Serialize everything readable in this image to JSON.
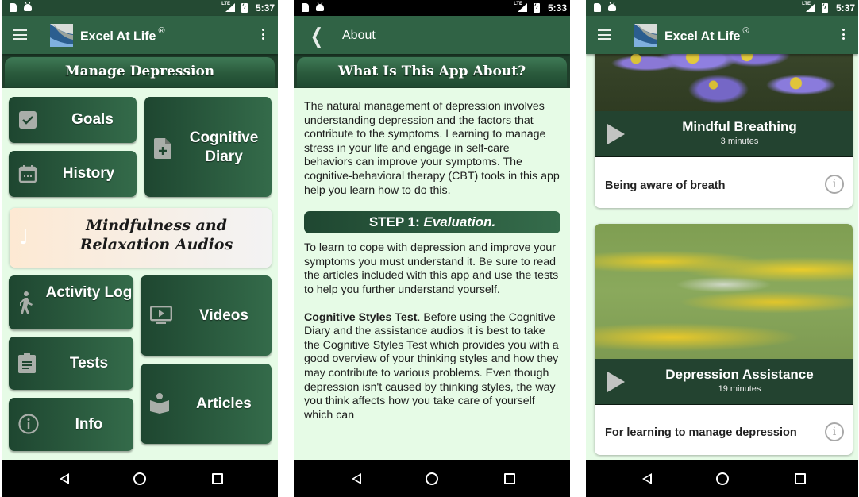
{
  "status_bars": {
    "phone1": {
      "time": "5:37",
      "network": "LTE"
    },
    "phone2": {
      "time": "5:33",
      "network": "LTE"
    },
    "phone3": {
      "time": "5:37",
      "network": "LTE"
    }
  },
  "app": {
    "title": "Excel At Life",
    "trademark": "®"
  },
  "home": {
    "banner": "Manage Depression",
    "tiles": {
      "goals": "Goals",
      "history": "History",
      "cognitive_diary": "Cognitive Diary",
      "audios": "Mindfulness and Relaxation Audios",
      "activity_log": "Activity Log",
      "tests": "Tests",
      "info": "Info",
      "videos": "Videos",
      "articles": "Articles"
    },
    "icons": {
      "goals": "checkbox-icon",
      "history": "calendar-icon",
      "cognitive_diary": "add-document-icon",
      "audios": "music-note-icon",
      "activity_log": "walking-person-icon",
      "tests": "clipboard-icon",
      "info": "info-icon",
      "videos": "video-screen-icon",
      "articles": "reader-book-icon"
    }
  },
  "about": {
    "appbar_title": "About",
    "banner": "What Is This App About?",
    "intro": "The natural management of depression involves understanding depression and the factors that contribute to the symptoms. Learning to manage stress in your life and engage in self-care behaviors can improve your symptoms. The cognitive-behavioral therapy (CBT) tools in this app help you learn how to do this.",
    "step1_prefix": "STEP 1: ",
    "step1_name": "Evaluation.",
    "step1_text": "To learn to cope with depression and improve your symptoms you must understand it. Be sure to read the articles included with this app and use the tests to help you further understand yourself.",
    "cst_bold": "Cognitive Styles Test",
    "cst_text": ". Before using the Cognitive Diary and the assistance audios it is best to take the Cognitive Styles Test which provides you with a good overview of your thinking styles and how they may contribute to various problems. Even though depression isn't caused by thinking styles, the way you think affects how you take care of yourself which can"
  },
  "audios": {
    "items": [
      {
        "title": "Mindful Breathing",
        "duration": "3 minutes",
        "description": "Being aware of breath"
      },
      {
        "title": "Depression Assistance",
        "duration": "19 minutes",
        "description": "For learning to manage depression"
      }
    ]
  },
  "navbar": {
    "buttons": [
      "back",
      "home",
      "recents"
    ]
  },
  "colors": {
    "app_bar": "#306345",
    "status_bar": "#244a33",
    "background": "#e6fbe6",
    "tile_dark": "#1e4630",
    "tile_light": "#346b4a",
    "audio_tile": "#fde9d3",
    "card_bar": "#234330"
  }
}
